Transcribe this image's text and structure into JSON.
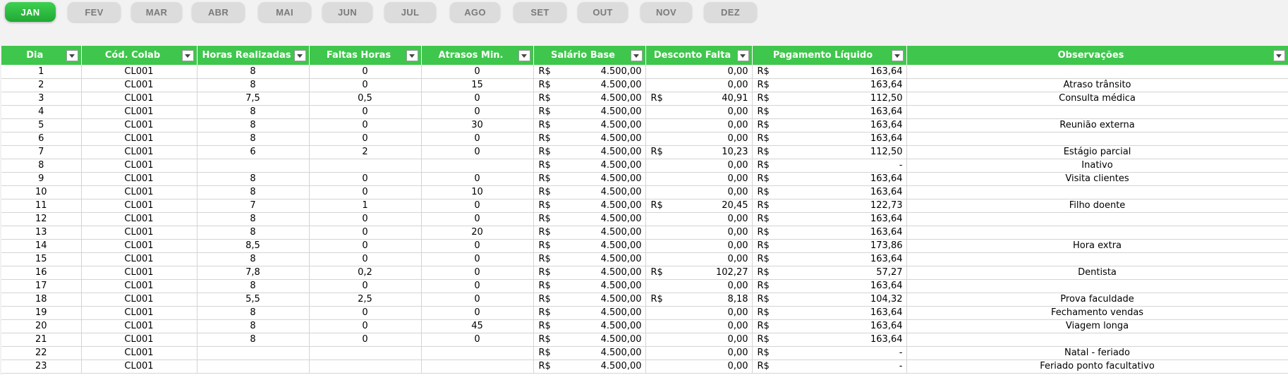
{
  "months": [
    "JAN",
    "FEV",
    "MAR",
    "ABR",
    "MAI",
    "JUN",
    "JUL",
    "AGO",
    "SET",
    "OUT",
    "NOV",
    "DEZ"
  ],
  "active_month": "JAN",
  "colors": {
    "accent": "#3fc64c",
    "month_inactive": "#dcdcdc"
  },
  "table": {
    "currency": "R$",
    "headers": [
      "Dia",
      "Cód. Colab",
      "Horas Realizadas",
      "Faltas Horas",
      "Atrasos Min.",
      "Salário Base",
      "Desconto Falta",
      "Pagamento Líquido",
      "Observações"
    ],
    "rows": [
      {
        "dia": "1",
        "colab": "CL001",
        "horas": "8",
        "faltas": "0",
        "atrasos": "0",
        "salario": "4.500,00",
        "desconto": "0,00",
        "desconto_cur": false,
        "pagamento": "163,64",
        "obs": ""
      },
      {
        "dia": "2",
        "colab": "CL001",
        "horas": "8",
        "faltas": "0",
        "atrasos": "15",
        "salario": "4.500,00",
        "desconto": "0,00",
        "desconto_cur": false,
        "pagamento": "163,64",
        "obs": "Atraso trânsito"
      },
      {
        "dia": "3",
        "colab": "CL001",
        "horas": "7,5",
        "faltas": "0,5",
        "atrasos": "0",
        "salario": "4.500,00",
        "desconto": "40,91",
        "desconto_cur": true,
        "pagamento": "112,50",
        "obs": "Consulta médica"
      },
      {
        "dia": "4",
        "colab": "CL001",
        "horas": "8",
        "faltas": "0",
        "atrasos": "0",
        "salario": "4.500,00",
        "desconto": "0,00",
        "desconto_cur": false,
        "pagamento": "163,64",
        "obs": ""
      },
      {
        "dia": "5",
        "colab": "CL001",
        "horas": "8",
        "faltas": "0",
        "atrasos": "30",
        "salario": "4.500,00",
        "desconto": "0,00",
        "desconto_cur": false,
        "pagamento": "163,64",
        "obs": "Reunião externa"
      },
      {
        "dia": "6",
        "colab": "CL001",
        "horas": "8",
        "faltas": "0",
        "atrasos": "0",
        "salario": "4.500,00",
        "desconto": "0,00",
        "desconto_cur": false,
        "pagamento": "163,64",
        "obs": ""
      },
      {
        "dia": "7",
        "colab": "CL001",
        "horas": "6",
        "faltas": "2",
        "atrasos": "0",
        "salario": "4.500,00",
        "desconto": "10,23",
        "desconto_cur": true,
        "pagamento": "112,50",
        "obs": "Estágio parcial"
      },
      {
        "dia": "8",
        "colab": "CL001",
        "horas": "",
        "faltas": "",
        "atrasos": "",
        "salario": "4.500,00",
        "desconto": "0,00",
        "desconto_cur": false,
        "pagamento": "-",
        "obs": "Inativo"
      },
      {
        "dia": "9",
        "colab": "CL001",
        "horas": "8",
        "faltas": "0",
        "atrasos": "0",
        "salario": "4.500,00",
        "desconto": "0,00",
        "desconto_cur": false,
        "pagamento": "163,64",
        "obs": "Visita clientes"
      },
      {
        "dia": "10",
        "colab": "CL001",
        "horas": "8",
        "faltas": "0",
        "atrasos": "10",
        "salario": "4.500,00",
        "desconto": "0,00",
        "desconto_cur": false,
        "pagamento": "163,64",
        "obs": ""
      },
      {
        "dia": "11",
        "colab": "CL001",
        "horas": "7",
        "faltas": "1",
        "atrasos": "0",
        "salario": "4.500,00",
        "desconto": "20,45",
        "desconto_cur": true,
        "pagamento": "122,73",
        "obs": "Filho doente"
      },
      {
        "dia": "12",
        "colab": "CL001",
        "horas": "8",
        "faltas": "0",
        "atrasos": "0",
        "salario": "4.500,00",
        "desconto": "0,00",
        "desconto_cur": false,
        "pagamento": "163,64",
        "obs": ""
      },
      {
        "dia": "13",
        "colab": "CL001",
        "horas": "8",
        "faltas": "0",
        "atrasos": "20",
        "salario": "4.500,00",
        "desconto": "0,00",
        "desconto_cur": false,
        "pagamento": "163,64",
        "obs": ""
      },
      {
        "dia": "14",
        "colab": "CL001",
        "horas": "8,5",
        "faltas": "0",
        "atrasos": "0",
        "salario": "4.500,00",
        "desconto": "0,00",
        "desconto_cur": false,
        "pagamento": "173,86",
        "obs": "Hora extra"
      },
      {
        "dia": "15",
        "colab": "CL001",
        "horas": "8",
        "faltas": "0",
        "atrasos": "0",
        "salario": "4.500,00",
        "desconto": "0,00",
        "desconto_cur": false,
        "pagamento": "163,64",
        "obs": ""
      },
      {
        "dia": "16",
        "colab": "CL001",
        "horas": "7,8",
        "faltas": "0,2",
        "atrasos": "0",
        "salario": "4.500,00",
        "desconto": "102,27",
        "desconto_cur": true,
        "pagamento": "57,27",
        "obs": "Dentista"
      },
      {
        "dia": "17",
        "colab": "CL001",
        "horas": "8",
        "faltas": "0",
        "atrasos": "0",
        "salario": "4.500,00",
        "desconto": "0,00",
        "desconto_cur": false,
        "pagamento": "163,64",
        "obs": ""
      },
      {
        "dia": "18",
        "colab": "CL001",
        "horas": "5,5",
        "faltas": "2,5",
        "atrasos": "0",
        "salario": "4.500,00",
        "desconto": "8,18",
        "desconto_cur": true,
        "pagamento": "104,32",
        "obs": "Prova faculdade"
      },
      {
        "dia": "19",
        "colab": "CL001",
        "horas": "8",
        "faltas": "0",
        "atrasos": "0",
        "salario": "4.500,00",
        "desconto": "0,00",
        "desconto_cur": false,
        "pagamento": "163,64",
        "obs": "Fechamento vendas"
      },
      {
        "dia": "20",
        "colab": "CL001",
        "horas": "8",
        "faltas": "0",
        "atrasos": "45",
        "salario": "4.500,00",
        "desconto": "0,00",
        "desconto_cur": false,
        "pagamento": "163,64",
        "obs": "Viagem longa"
      },
      {
        "dia": "21",
        "colab": "CL001",
        "horas": "8",
        "faltas": "0",
        "atrasos": "0",
        "salario": "4.500,00",
        "desconto": "0,00",
        "desconto_cur": false,
        "pagamento": "163,64",
        "obs": ""
      },
      {
        "dia": "22",
        "colab": "CL001",
        "horas": "",
        "faltas": "",
        "atrasos": "",
        "salario": "4.500,00",
        "desconto": "0,00",
        "desconto_cur": false,
        "pagamento": "-",
        "obs": "Natal - feriado"
      },
      {
        "dia": "23",
        "colab": "CL001",
        "horas": "",
        "faltas": "",
        "atrasos": "",
        "salario": "4.500,00",
        "desconto": "0,00",
        "desconto_cur": false,
        "pagamento": "-",
        "obs": "Feriado ponto facultativo"
      }
    ]
  }
}
